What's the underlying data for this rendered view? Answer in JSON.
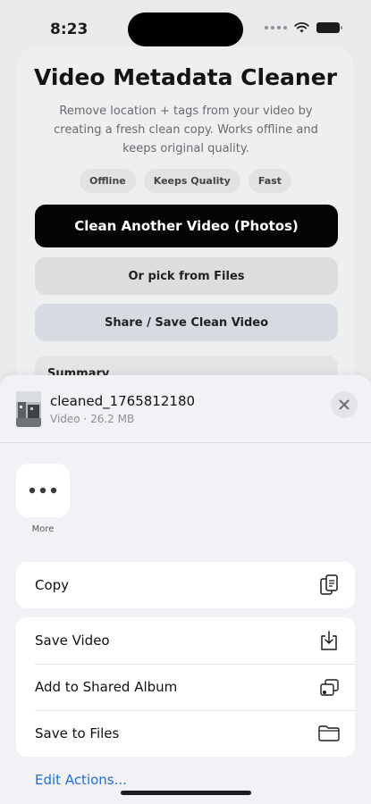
{
  "status_bar": {
    "time": "8:23"
  },
  "app": {
    "title": "Video Metadata Cleaner",
    "description": "Remove location + tags from your video by creating a fresh clean copy. Works offline and keeps original quality.",
    "chips": [
      "Offline",
      "Keeps Quality",
      "Fast"
    ],
    "primary_button": "Clean Another Video (Photos)",
    "files_button": "Or pick from Files",
    "share_button": "Share / Save Clean Video",
    "summary_label": "Summary"
  },
  "share_sheet": {
    "file_name": "cleaned_1765812180",
    "file_meta": "Video · 26.2 MB",
    "more_label": "More",
    "actions_group1": [
      {
        "label": "Copy",
        "icon": "copy-icon"
      }
    ],
    "actions_group2": [
      {
        "label": "Save Video",
        "icon": "save-download-icon"
      },
      {
        "label": "Add to Shared Album",
        "icon": "shared-album-icon"
      },
      {
        "label": "Save to Files",
        "icon": "folder-icon"
      }
    ],
    "edit_actions": "Edit Actions...",
    "accent_color": "#1e6fd9"
  }
}
